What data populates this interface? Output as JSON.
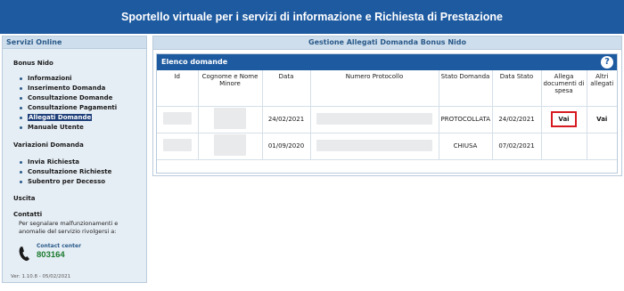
{
  "header": {
    "title": "Sportello virtuale per i servizi di informazione e Richiesta di Prestazione"
  },
  "sidebar": {
    "title": "Servizi Online",
    "bonus_nido": {
      "heading": "Bonus Nido",
      "items": [
        {
          "label": "Informazioni"
        },
        {
          "label": "Inserimento Domanda"
        },
        {
          "label": "Consultazione Domande"
        },
        {
          "label": "Consultazione Pagamenti"
        },
        {
          "label": "Allegati Domande",
          "active": true
        },
        {
          "label": "Manuale Utente"
        }
      ]
    },
    "variazioni": {
      "heading": "Variazioni Domanda",
      "items": [
        {
          "label": "Invia Richiesta"
        },
        {
          "label": "Consultazione Richieste"
        },
        {
          "label": "Subentro per Decesso"
        }
      ]
    },
    "uscita": "Uscita",
    "contatti": {
      "heading": "Contatti",
      "text": "Per segnalare malfunzionamenti e anomalie del servizio rivolgersi a:",
      "contact_center_label": "Contact center",
      "contact_center_number": "803164"
    },
    "version": "Ver: 1.10.8 - 05/02/2021"
  },
  "main": {
    "title": "Gestione Allegati Domanda Bonus Nido",
    "panel_title": "Elenco domande",
    "help_symbol": "?",
    "columns": [
      "Id",
      "Cognome e Nome Minore",
      "Data",
      "Numero Protocollo",
      "Stato Domanda",
      "Data Stato",
      "Allega documenti di spesa",
      "Altri allegati"
    ],
    "rows": [
      {
        "data": "24/02/2021",
        "stato": "PROTOCOLLATA",
        "data_stato": "24/02/2021",
        "allega": "Vai",
        "altri": "Vai"
      },
      {
        "data": "01/09/2020",
        "stato": "CHIUSA",
        "data_stato": "07/02/2021",
        "allega": "",
        "altri": ""
      }
    ]
  },
  "colors": {
    "brand_blue": "#1e5aa0",
    "highlight_red": "#d71920",
    "contact_green": "#1b7a2e"
  },
  "icons": {
    "help": "question-circle-icon",
    "phone": "phone-icon"
  }
}
